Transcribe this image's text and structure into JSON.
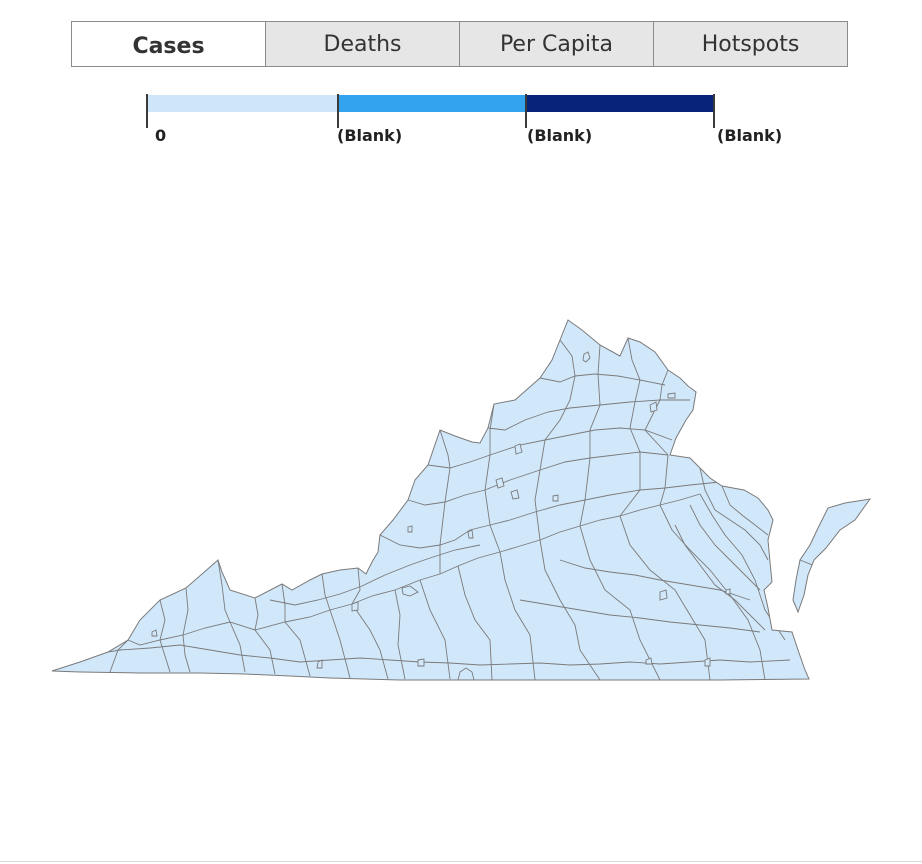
{
  "tabs": [
    {
      "label": "Cases",
      "active": true
    },
    {
      "label": "Deaths",
      "active": false
    },
    {
      "label": "Per Capita",
      "active": false
    },
    {
      "label": "Hotspots",
      "active": false
    }
  ],
  "legend": {
    "colors": [
      "#cfe6f9",
      "#33a3f0",
      "#08237a"
    ],
    "labels": [
      "0",
      "(Blank)",
      "(Blank)",
      "(Blank)"
    ]
  },
  "map": {
    "region": "Virginia",
    "fill": "#d1e7fa",
    "stroke": "#7a7a7a"
  }
}
